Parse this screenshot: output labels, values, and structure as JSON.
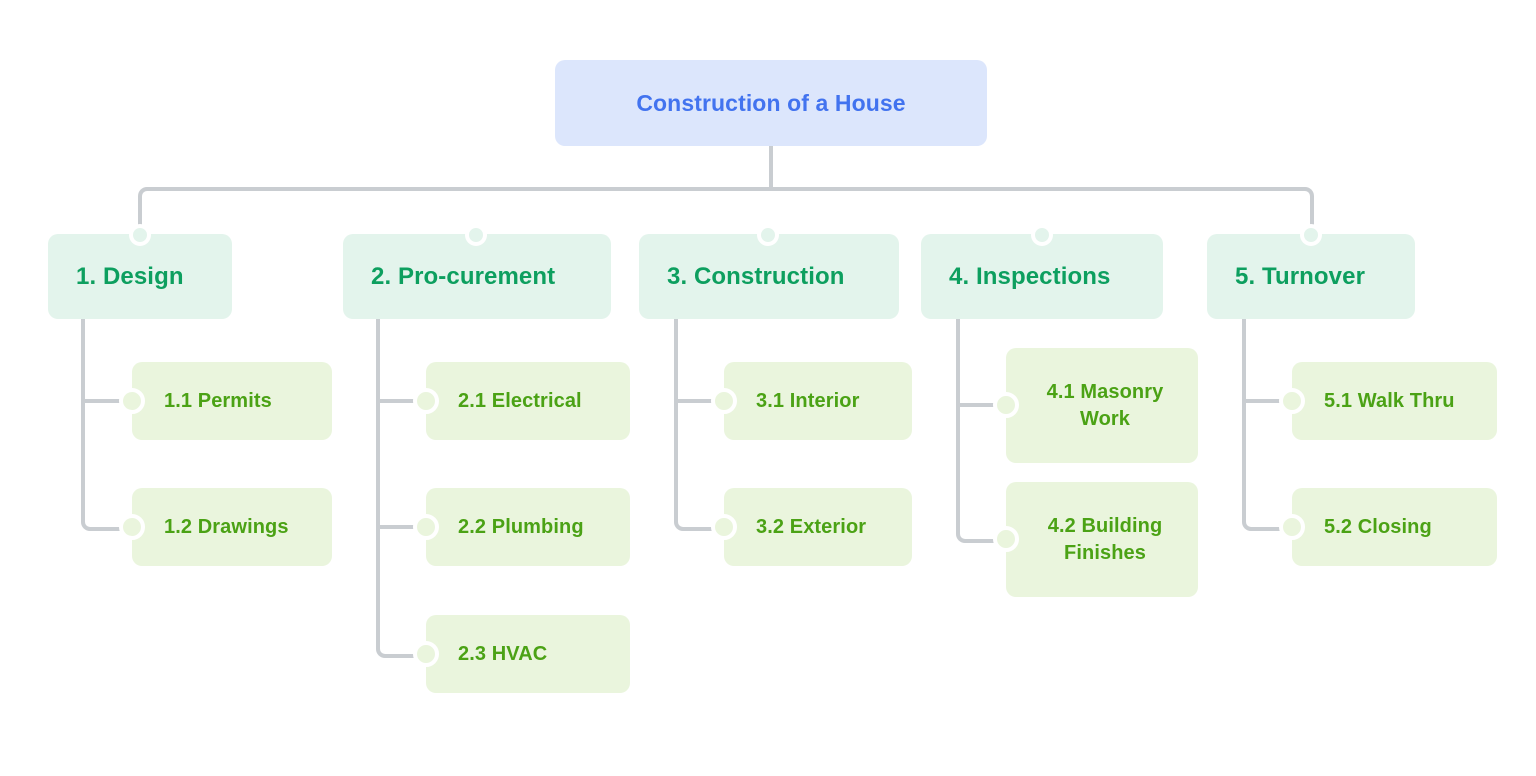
{
  "diagram": {
    "type": "work-breakdown-structure",
    "orientation": "top-down",
    "colors": {
      "root_bg": "#dce6fc",
      "root_text": "#4273ef",
      "level1_bg": "#e3f4ec",
      "level1_text": "#0d9f5f",
      "leaf_bg": "#eaf5dd",
      "leaf_text": "#4ba215",
      "connector": "#c9cdd1",
      "canvas_bg": "#ffffff"
    }
  },
  "root": {
    "label": "Construction of a House"
  },
  "branches": [
    {
      "label": "1. Design",
      "children": [
        {
          "label": "1.1 Permits"
        },
        {
          "label": "1.2 Drawings"
        }
      ]
    },
    {
      "label": "2. Pro-curement",
      "children": [
        {
          "label": "2.1 Electrical"
        },
        {
          "label": "2.2 Plumbing"
        },
        {
          "label": "2.3 HVAC"
        }
      ]
    },
    {
      "label": "3. Construction",
      "children": [
        {
          "label": "3.1 Interior"
        },
        {
          "label": "3.2 Exterior"
        }
      ]
    },
    {
      "label": "4. Inspections",
      "children": [
        {
          "label": "4.1 Masonry Work"
        },
        {
          "label": "4.2 Building Finishes"
        }
      ]
    },
    {
      "label": "5. Turnover",
      "children": [
        {
          "label": "5.1 Walk Thru"
        },
        {
          "label": "5.2 Closing"
        }
      ]
    }
  ]
}
